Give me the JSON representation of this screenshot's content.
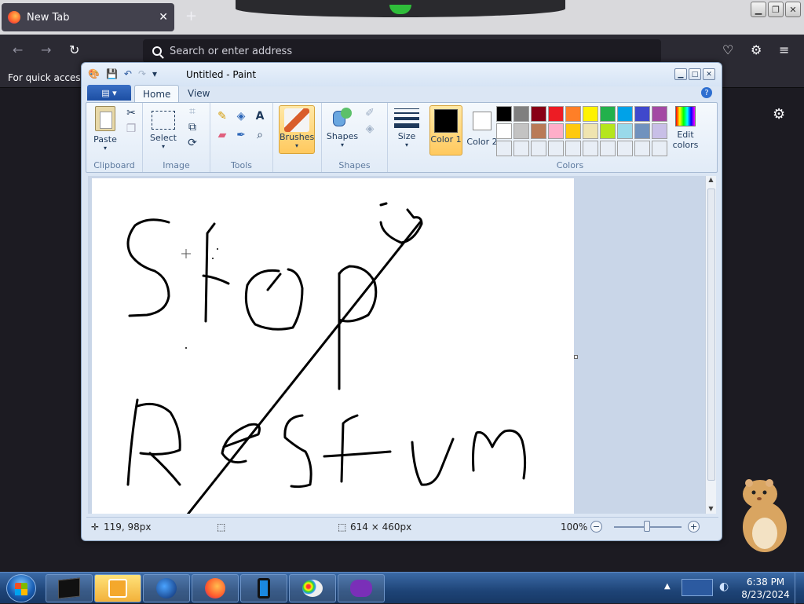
{
  "browser": {
    "tab_title": "New Tab",
    "tab_close": "✕",
    "new_tab": "+",
    "url_placeholder": "Search or enter address",
    "bookmark_hint": "For quick access,"
  },
  "paint": {
    "title": "Untitled - Paint",
    "tabs": [
      "Home",
      "View"
    ],
    "file_menu": "▤ ▾",
    "groups": {
      "clipboard": {
        "label": "Clipboard",
        "paste": "Paste"
      },
      "image": {
        "label": "Image",
        "select": "Select"
      },
      "tools": {
        "label": "Tools"
      },
      "brushes": {
        "label": "Brushes"
      },
      "shapes": {
        "label": "Shapes",
        "shapes_btn": "Shapes"
      },
      "size": {
        "label": "Size"
      },
      "colors": {
        "label": "Colors",
        "color1": "Color 1",
        "color2": "Color 2",
        "edit": "Edit colors",
        "color1_value": "#000000",
        "color2_value": "#ffffff",
        "palette_row1": [
          "#000000",
          "#7f7f7f",
          "#880015",
          "#ed1c24",
          "#ff7f27",
          "#fff200",
          "#22b14c",
          "#00a2e8",
          "#3f48cc",
          "#a349a4"
        ],
        "palette_row2": [
          "#ffffff",
          "#c3c3c3",
          "#b97a57",
          "#ffaec9",
          "#ffc90e",
          "#efe4b0",
          "#b5e61d",
          "#99d9ea",
          "#7092be",
          "#c8bfe7"
        ]
      }
    },
    "status": {
      "cursor_pos": "119, 98px",
      "canvas_size": "614 × 460px",
      "zoom": "100%"
    }
  },
  "taskbar": {
    "time": "6:38 PM",
    "date": "8/23/2024"
  }
}
